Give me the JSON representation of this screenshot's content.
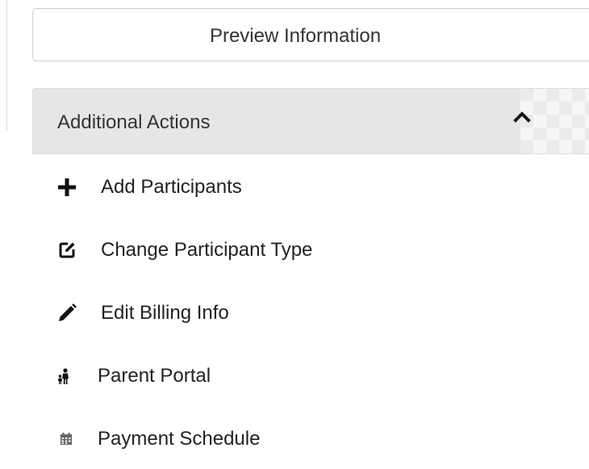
{
  "preview": {
    "label": "Preview Information"
  },
  "panel": {
    "title": "Additional Actions",
    "toggle_icon": "chevron-up-icon"
  },
  "actions": [
    {
      "label": "Add Participants",
      "icon": "plus-icon"
    },
    {
      "label": "Change Participant Type",
      "icon": "edit-square-icon"
    },
    {
      "label": "Edit Billing Info",
      "icon": "pencil-icon"
    },
    {
      "label": "Parent Portal",
      "icon": "family-icon"
    },
    {
      "label": "Payment Schedule",
      "icon": "calendar-icon"
    }
  ]
}
